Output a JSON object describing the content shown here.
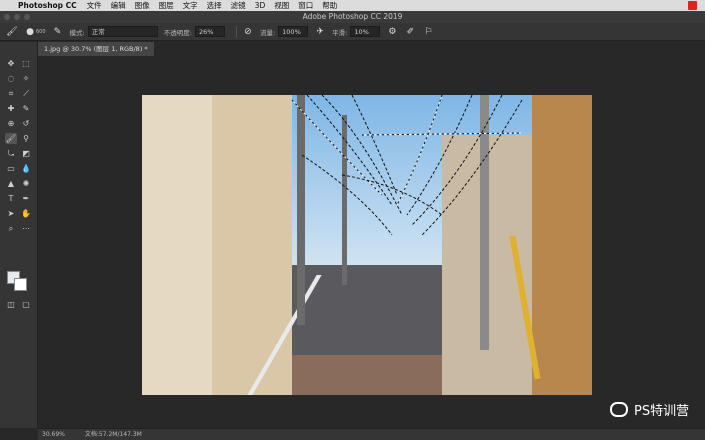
{
  "menubar": {
    "app_name": "Photoshop CC",
    "items": [
      "文件",
      "编辑",
      "图像",
      "图层",
      "文字",
      "选择",
      "滤镜",
      "3D",
      "视图",
      "窗口",
      "帮助"
    ]
  },
  "window": {
    "title": "Adobe Photoshop CC 2019"
  },
  "options": {
    "brush_size": "600",
    "mode_label": "模式:",
    "mode_value": "正常",
    "opacity_label": "不透明度:",
    "opacity_value": "26%",
    "flow_label": "流量:",
    "flow_value": "100%",
    "smoothing_label": "平滑:",
    "smoothing_value": "10%"
  },
  "tab": {
    "label": "1.jpg @ 30.7% (图层 1, RGB/8) *"
  },
  "status": {
    "zoom": "30.69%",
    "doc": "文档:57.2M/147.3M"
  },
  "watermark": {
    "text": "PS特训营"
  },
  "colors": {
    "foreground": "#e6e9ef",
    "background": "#ffffff",
    "accent": "#d22222"
  },
  "icons": {
    "apple": "apple-icon",
    "brush": "brush-icon",
    "airbrush": "airbrush-icon",
    "settings": "gear-icon"
  }
}
